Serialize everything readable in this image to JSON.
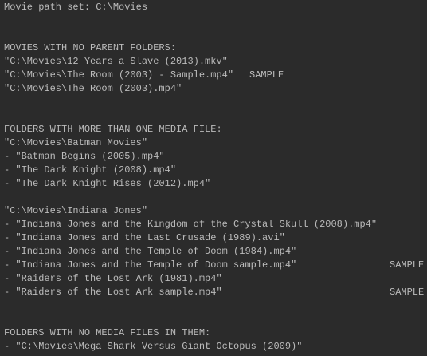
{
  "colors": {
    "background": "#2b2b2b",
    "text": "#bbbbbb"
  },
  "header": "Movie path set: C:\\Movies",
  "no_parent": {
    "heading": "MOVIES WITH NO PARENT FOLDERS:",
    "items": [
      {
        "path": "\"C:\\Movies\\12 Years a Slave (2013).mkv\"",
        "tag": ""
      },
      {
        "path": "\"C:\\Movies\\The Room (2003) - Sample.mp4\"",
        "tag": "SAMPLE"
      },
      {
        "path": "\"C:\\Movies\\The Room (2003).mp4\"",
        "tag": ""
      }
    ]
  },
  "multi_media": {
    "heading": "FOLDERS WITH MORE THAN ONE MEDIA FILE:",
    "folders": [
      {
        "path": "\"C:\\Movies\\Batman Movies\"",
        "files": [
          {
            "name": "- \"Batman Begins (2005).mp4\"",
            "tag": ""
          },
          {
            "name": "- \"The Dark Knight (2008).mp4\"",
            "tag": ""
          },
          {
            "name": "- \"The Dark Knight Rises (2012).mp4\"",
            "tag": ""
          }
        ]
      },
      {
        "path": "\"C:\\Movies\\Indiana Jones\"",
        "files": [
          {
            "name": "- \"Indiana Jones and the Kingdom of the Crystal Skull (2008).mp4\"",
            "tag": ""
          },
          {
            "name": "- \"Indiana Jones and the Last Crusade (1989).avi\"",
            "tag": ""
          },
          {
            "name": "- \"Indiana Jones and the Temple of Doom (1984).mp4\"",
            "tag": ""
          },
          {
            "name": "- \"Indiana Jones and the Temple of Doom sample.mp4\"",
            "tag": "SAMPLE"
          },
          {
            "name": "- \"Raiders of the Lost Ark (1981).mp4\"",
            "tag": ""
          },
          {
            "name": "- \"Raiders of the Lost Ark sample.mp4\"",
            "tag": "SAMPLE"
          }
        ]
      }
    ]
  },
  "no_media": {
    "heading": "FOLDERS WITH NO MEDIA FILES IN THEM:",
    "items": [
      "- \"C:\\Movies\\Mega Shark Versus Giant Octopus (2009)\""
    ]
  }
}
